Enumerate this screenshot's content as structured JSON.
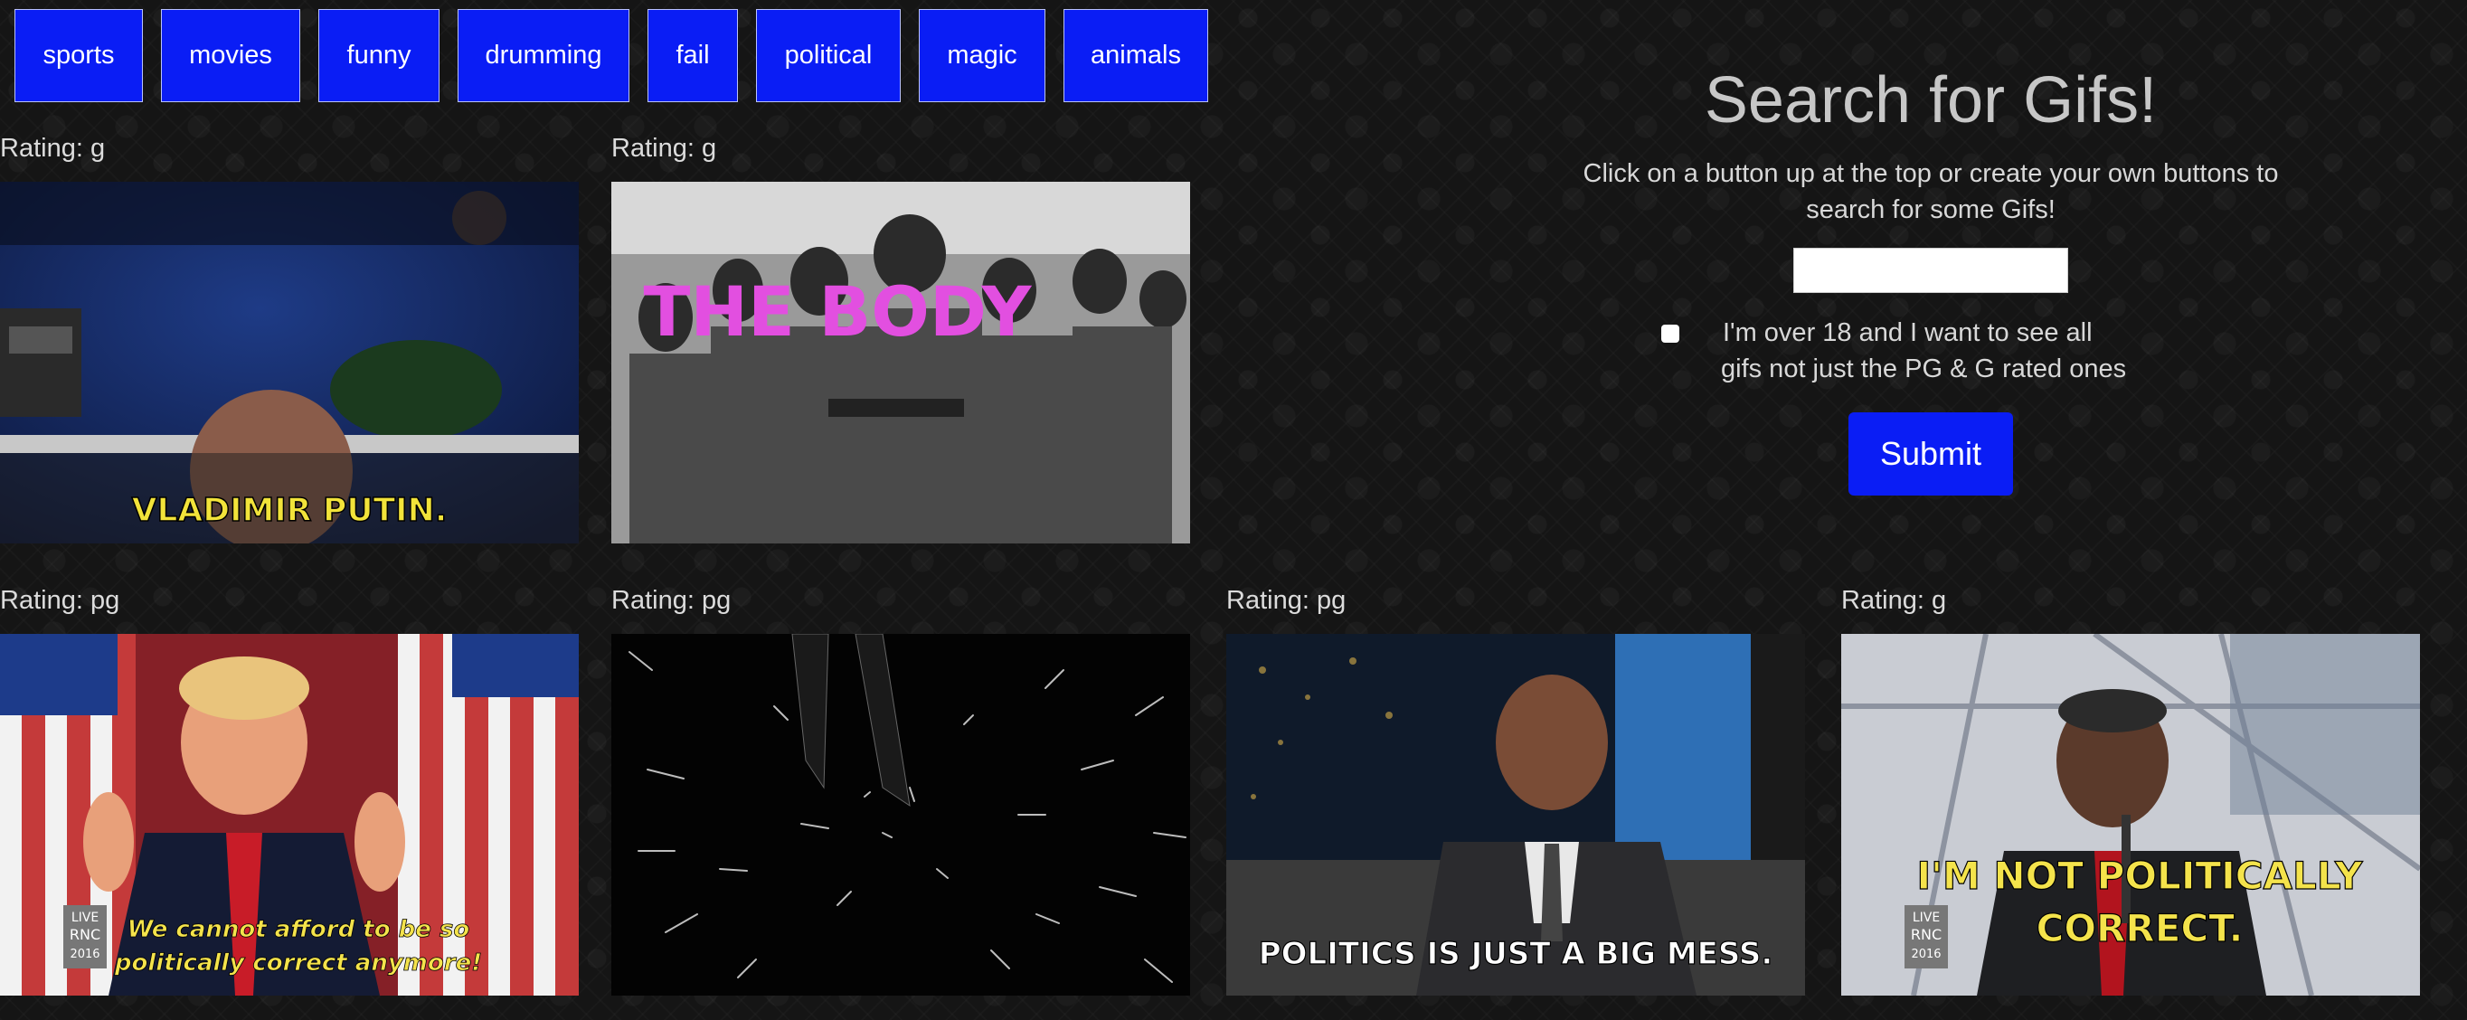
{
  "topics": [
    "sports",
    "movies",
    "funny",
    "drumming",
    "fail",
    "political",
    "magic",
    "animals"
  ],
  "search": {
    "title": "Search for Gifs!",
    "subtitle": "Click on a button up at the top or create your own buttons to search for some Gifs!",
    "input_value": "",
    "checkbox_label": "I'm over 18 and I want to see all gifs not just the PG & G rated ones",
    "checkbox_label_line1": "I'm over 18 and I want to see all",
    "checkbox_label_line2": "gifs not just the PG & G rated ones",
    "submit_label": "Submit"
  },
  "gifs": [
    {
      "rating": "Rating: g",
      "caption": "VLADIMIR PUTIN."
    },
    {
      "rating": "Rating: g",
      "caption": "THE BODY"
    },
    {
      "rating": "Rating: pg",
      "caption_line1": "We cannot afford to be so",
      "caption_line2": "politically correct anymore!",
      "badge_line1": "LIVE",
      "badge_line2": "RNC",
      "badge_line3": "2016"
    },
    {
      "rating": "Rating: pg",
      "caption": ""
    },
    {
      "rating": "Rating: pg",
      "caption": "POLITICS IS JUST A BIG MESS."
    },
    {
      "rating": "Rating: g",
      "caption_line1": "I'M NOT POLITICALLY",
      "caption_line2": "CORRECT.",
      "badge_line1": "LIVE",
      "badge_line2": "RNC",
      "badge_line3": "2016"
    }
  ],
  "colors": {
    "button_blue": "#0a1df5",
    "background": "#151515"
  }
}
